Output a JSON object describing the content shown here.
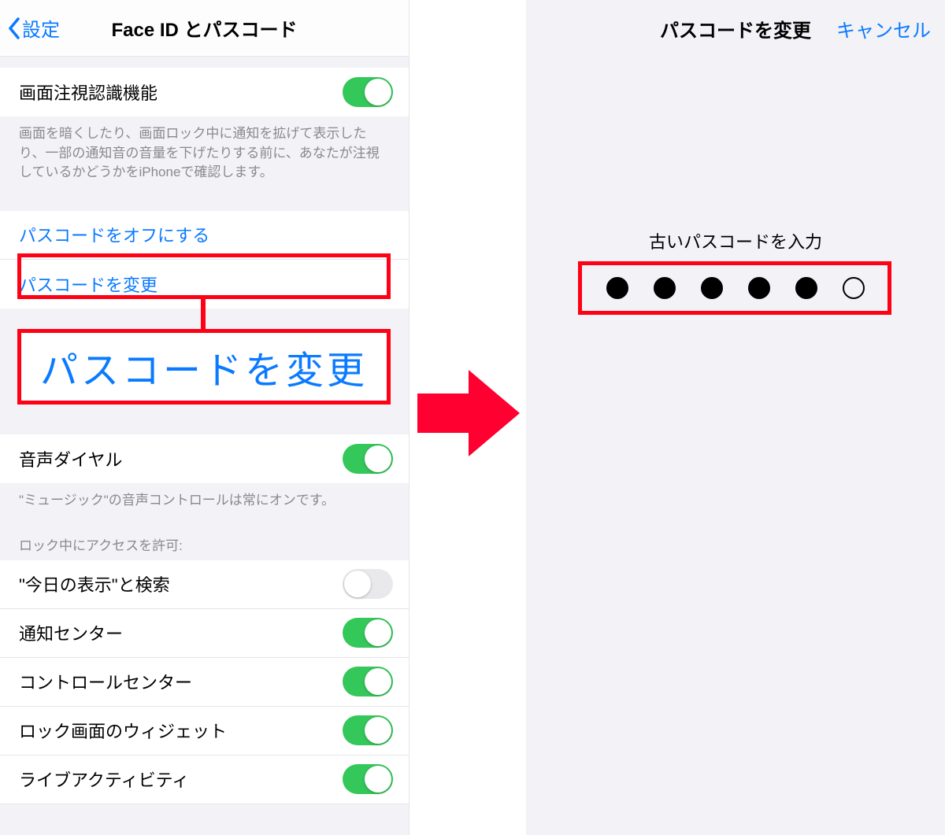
{
  "left": {
    "back_label": "設定",
    "title": "Face ID とパスコード",
    "attention_label": "画面注視認識機能",
    "attention_on": true,
    "attention_footer": "画面を暗くしたり、画面ロック中に通知を拡げて表示したり、一部の通知音の音量を下げたりする前に、あなたが注視しているかどうかをiPhoneで確認します。",
    "passcode_off_label": "パスコードをオフにする",
    "passcode_change_label": "パスコードを変更",
    "voice_dial_label": "音声ダイヤル",
    "voice_dial_on": true,
    "voice_dial_footer": "\"ミュージック\"の音声コントロールは常にオンです。",
    "lock_access_header": "ロック中にアクセスを許可:",
    "lock_items": [
      {
        "label": "\"今日の表示\"と検索",
        "on": false
      },
      {
        "label": "通知センター",
        "on": true
      },
      {
        "label": "コントロールセンター",
        "on": true
      },
      {
        "label": "ロック画面のウィジェット",
        "on": true
      },
      {
        "label": "ライブアクティビティ",
        "on": true
      }
    ],
    "annotation_big_label": "パスコードを変更"
  },
  "right": {
    "title": "パスコードを変更",
    "cancel_label": "キャンセル",
    "prompt": "古いパスコードを入力",
    "dots_total": 6,
    "dots_filled": 5
  },
  "colors": {
    "ios_blue": "#0a7aff",
    "ios_green": "#34c759",
    "annotation_red": "#ff0014"
  }
}
